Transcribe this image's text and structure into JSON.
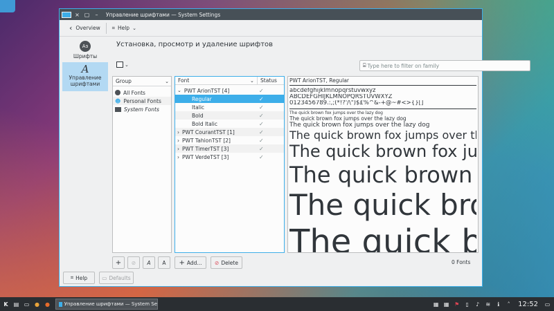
{
  "window": {
    "title": "Управление шрифтами — System Settings",
    "nav_back": "Overview",
    "nav_help": "Help"
  },
  "sidebar": {
    "items": [
      {
        "label": "Шрифты",
        "icon": "fonts-icon",
        "glyph": "Aз"
      },
      {
        "label": "Управление шрифтами",
        "icon": "font-management-icon",
        "glyph": "A"
      }
    ]
  },
  "main": {
    "title": "Установка, просмотр и удаление шрифтов",
    "filter_placeholder": "Type here to filter on family",
    "group_header": "Group",
    "groups": [
      "All Fonts",
      "Personal Fonts",
      "System Fonts"
    ],
    "font_header": "Font",
    "status_header": "Status",
    "fonts": [
      {
        "label": "PWT ArionTST [4]",
        "level": 0,
        "expanded": true
      },
      {
        "label": "Regular",
        "level": 1,
        "selected": true
      },
      {
        "label": "Italic",
        "level": 1
      },
      {
        "label": "Bold",
        "level": 1
      },
      {
        "label": "Bold Italic",
        "level": 1
      },
      {
        "label": "PWT CourantTST [1]",
        "level": 0
      },
      {
        "label": "PWT TahionTST [2]",
        "level": 0
      },
      {
        "label": "PWT TimerTST [3]",
        "level": 0
      },
      {
        "label": "PWT VerdeTST [3]",
        "level": 0
      }
    ],
    "preview": {
      "title": "PWT ArionTST, Regular",
      "lower": "abcdefghijklmnopqrstuvwxyz",
      "upper": "ABCDEFGHIJKLMNOPQRSTUVWXYZ",
      "digits": "0123456789.:,;(*!?'/\\\")$£%^&-+@~#<>{}[]",
      "sample": "The quick brown fox jumps over the lazy dog"
    },
    "add_label": "Add...",
    "delete_label": "Delete",
    "font_count": "0 Fonts"
  },
  "footer": {
    "help_label": "Help",
    "defaults_label": "Defaults"
  },
  "taskbar": {
    "task_label": "Управление шрифтами — System Se",
    "clock": "12:52"
  },
  "colors": {
    "accent": "#3daee9",
    "titlebar": "#475057",
    "taskbar": "#2a2e32"
  }
}
